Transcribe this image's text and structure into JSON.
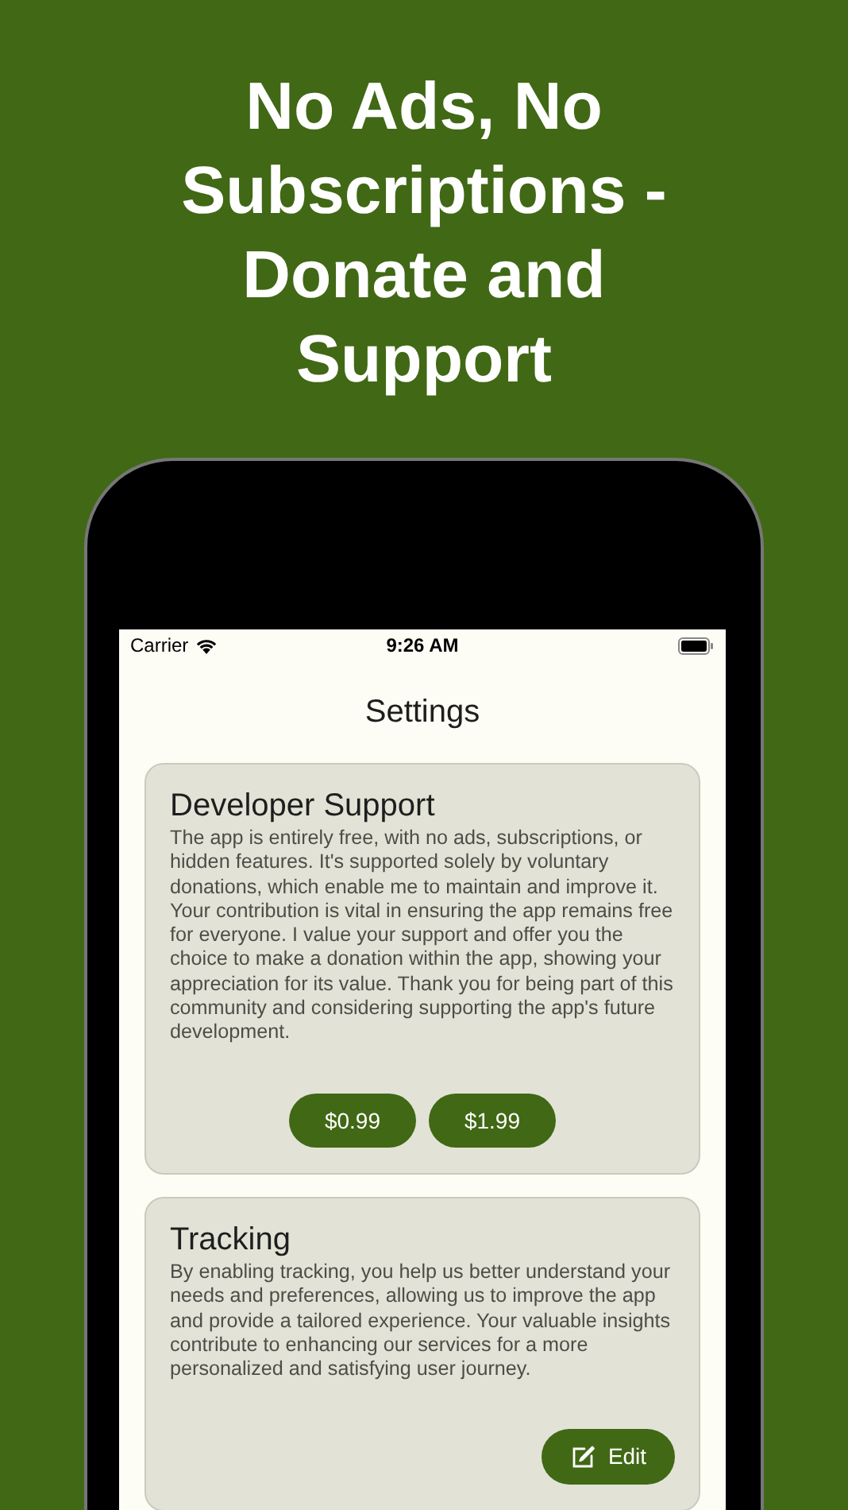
{
  "headline": "No Ads, No Subscriptions - Donate and Support",
  "status_bar": {
    "carrier": "Carrier",
    "time": "9:26 AM"
  },
  "nav": {
    "title": "Settings"
  },
  "cards": [
    {
      "title": "Developer Support",
      "body": "The app is entirely free, with no ads, subscriptions, or hidden features. It's supported solely by voluntary donations, which enable me to maintain and improve it. Your contribution is vital in ensuring the app remains free for everyone. I value your support and offer you the choice to make a donation within the app, showing your appreciation for its value. Thank you for being part of this community and considering supporting the app's future development.",
      "buttons": [
        {
          "label": "$0.99",
          "kind": "price"
        },
        {
          "label": "$1.99",
          "kind": "price"
        }
      ]
    },
    {
      "title": "Tracking",
      "body": "By enabling tracking, you help us better understand your needs and preferences, allowing us to improve the app and provide a tailored experience. Your valuable insights contribute to enhancing our services for a more personalized and satisfying user journey.",
      "buttons": [
        {
          "label": "Edit",
          "kind": "edit"
        }
      ]
    }
  ]
}
